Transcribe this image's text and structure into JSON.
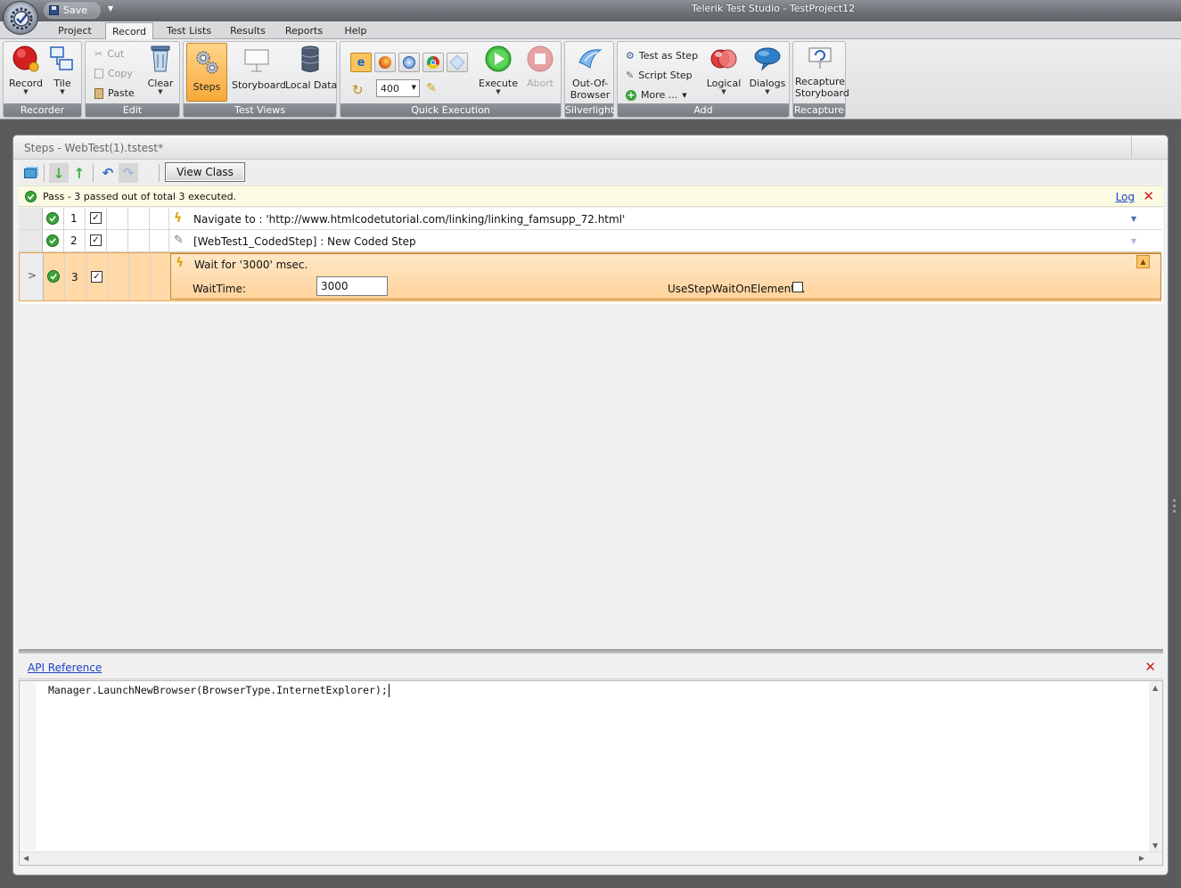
{
  "window": {
    "title": "Telerik Test Studio - TestProject12",
    "qat_save_label": "Save"
  },
  "ribbon": {
    "tabs": [
      "Project",
      "Record",
      "Test Lists",
      "Results",
      "Reports",
      "Help"
    ],
    "active_tab": "Record",
    "groups": {
      "recorder": {
        "label": "Recorder",
        "record": "Record",
        "tile": "Tile"
      },
      "edit": {
        "label": "Edit",
        "cut": "Cut",
        "copy": "Copy",
        "paste": "Paste",
        "clear": "Clear"
      },
      "test_views": {
        "label": "Test Views",
        "steps": "Steps",
        "storyboard": "Storyboard",
        "local_data": "Local Data"
      },
      "quick_execution": {
        "label": "Quick Execution",
        "speed_value": "400",
        "execute": "Execute",
        "abort": "Abort"
      },
      "silverlight": {
        "label": "Silverlight",
        "oob": "Out-Of-Browser"
      },
      "add": {
        "label": "Add",
        "test_as_step": "Test as Step",
        "script_step": "Script Step",
        "more": "More ...",
        "logical": "Logical",
        "dialogs": "Dialogs"
      },
      "recapture": {
        "label": "Recapture",
        "recapture_storyboard": "Recapture Storyboard"
      }
    }
  },
  "panel": {
    "title": "Steps - WebTest(1).tstest*",
    "toolbar": {
      "view_class": "View Class"
    },
    "status": {
      "text": "Pass - 3 passed out of total 3 executed.",
      "log": "Log"
    },
    "steps": [
      {
        "num": "1",
        "checked": "✓",
        "text": "Navigate to : 'http://www.htmlcodetutorial.com/linking/linking_famsupp_72.html'"
      },
      {
        "num": "2",
        "checked": "✓",
        "text": "[WebTest1_CodedStep] : New Coded Step"
      },
      {
        "num": "3",
        "checked": "✓",
        "text": "Wait for '3000' msec.",
        "row_header": ">",
        "wait_time_label": "WaitTime:",
        "wait_time_value": "3000",
        "use_step_label": "UseStepWaitOnElement..."
      }
    ],
    "api": {
      "link": "API Reference",
      "code": "Manager.LaunchNewBrowser(BrowserType.InternetExplorer);"
    }
  },
  "colors": {
    "pass_green": "#3aa33a",
    "selected_row": "#ffd9a8",
    "link_blue": "#1f41c8",
    "close_red": "#c7221f"
  }
}
